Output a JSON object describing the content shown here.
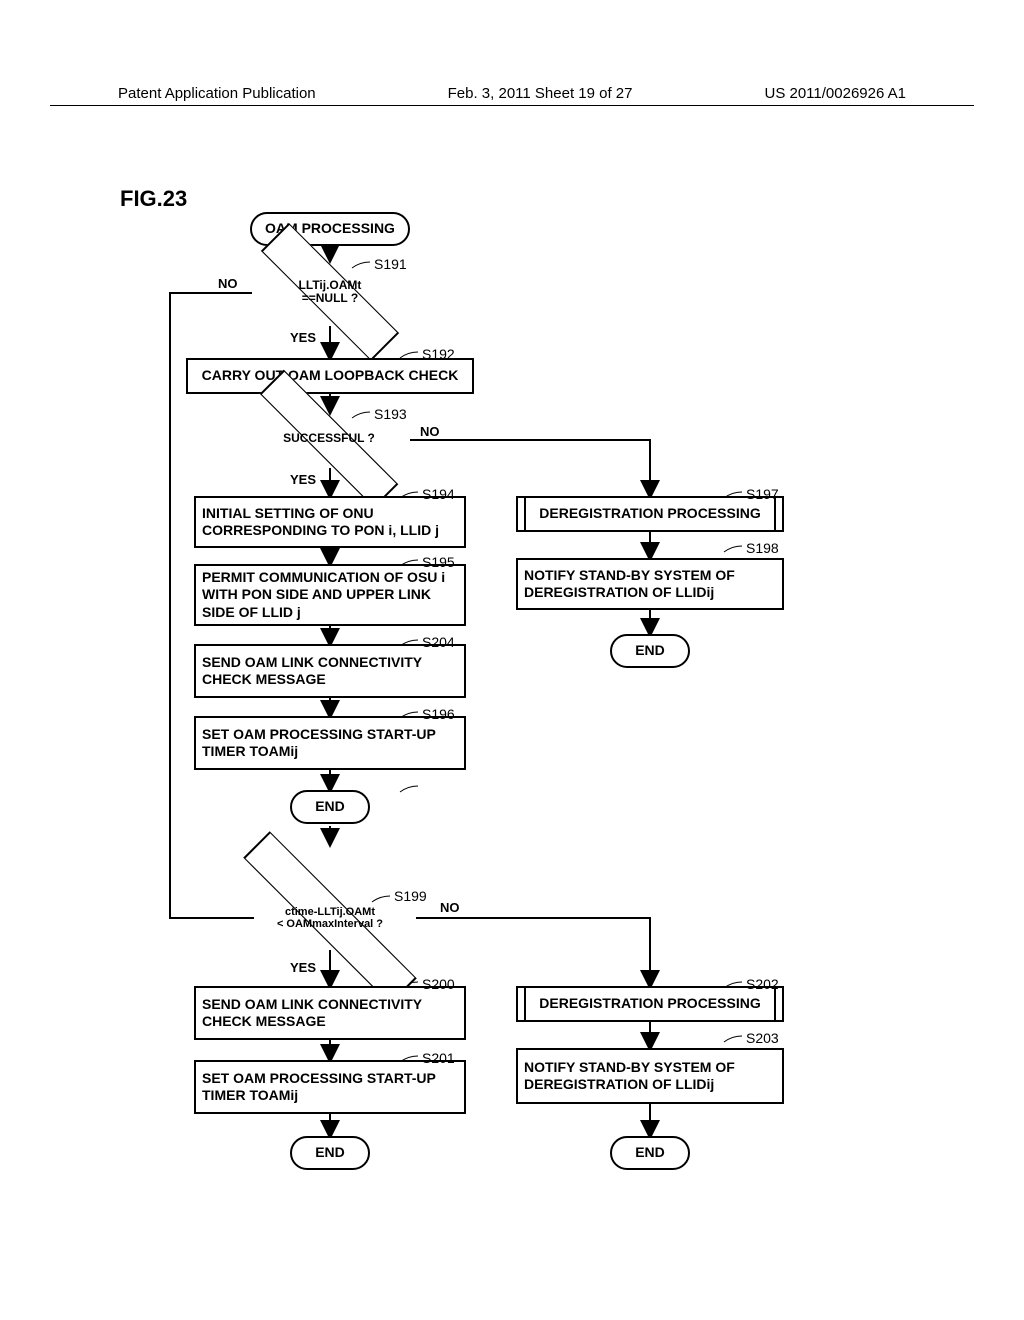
{
  "header": {
    "left": "Patent Application Publication",
    "center": "Feb. 3, 2011  Sheet 19 of 27",
    "right": "US 2011/0026926 A1"
  },
  "fig_label": "FIG.23",
  "labels": {
    "no": "NO",
    "yes": "YES"
  },
  "steps": {
    "s191": "S191",
    "s192": "S192",
    "s193": "S193",
    "s194": "S194",
    "s195": "S195",
    "s196": "S196",
    "s197": "S197",
    "s198": "S198",
    "s199": "S199",
    "s200": "S200",
    "s201": "S201",
    "s202": "S202",
    "s203": "S203",
    "s204": "S204"
  },
  "nodes": {
    "start": "OAM PROCESSING",
    "d191": "LLTij.OAMt\n==NULL ?",
    "r192": "CARRY OUT OAM LOOPBACK CHECK",
    "d193": "SUCCESSFUL ?",
    "r194": "INITIAL SETTING OF ONU CORRESPONDING TO PON i, LLID j",
    "r195": "PERMIT COMMUNICATION OF OSU i WITH PON SIDE AND UPPER LINK SIDE OF LLID j",
    "r204": "SEND OAM LINK CONNECTIVITY CHECK MESSAGE",
    "r196": "SET OAM PROCESSING START-UP TIMER TOAMij",
    "end1": "END",
    "sub197": "DEREGISTRATION PROCESSING",
    "r198": "NOTIFY STAND-BY SYSTEM OF DEREGISTRATION OF LLIDij",
    "end2": "END",
    "d199": "ctime-LLTij.OAMt\n< OAMmaxInterval ?",
    "r200": "SEND OAM LINK CONNECTIVITY CHECK MESSAGE",
    "r201": "SET OAM PROCESSING START-UP TIMER TOAMij",
    "end3": "END",
    "sub202": "DEREGISTRATION PROCESSING",
    "r203": "NOTIFY STAND-BY SYSTEM OF DEREGISTRATION OF LLIDij",
    "end4": "END"
  }
}
